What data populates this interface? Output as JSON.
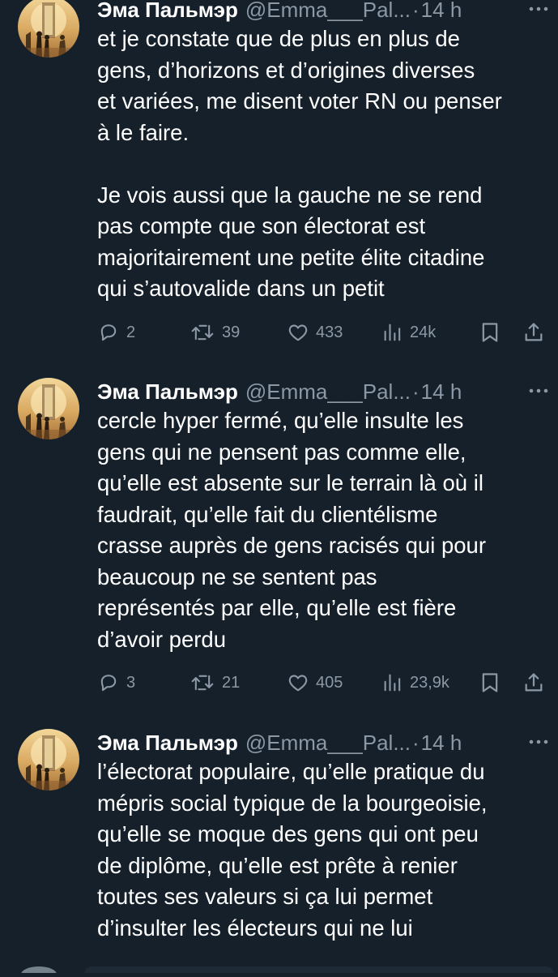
{
  "tweets": [
    {
      "name": "Эма Пальмэр",
      "handle": "@Emma___Pal...",
      "dot": "·",
      "time": "14 h",
      "text": "et je constate que de plus en plus de\ngens, d’horizons et d’origines diverses\net variées, me disent voter RN ou penser\nà le faire.\n\nJe vois aussi que la gauche ne se rend\npas compte que son électorat est\nmajoritairement une petite élite citadine\nqui s’autovalide dans un petit",
      "replies": "2",
      "retweets": "39",
      "likes": "433",
      "views": "24k"
    },
    {
      "name": "Эма Пальмэр",
      "handle": "@Emma___Pal...",
      "dot": "·",
      "time": "14 h",
      "text": "cercle hyper fermé, qu’elle insulte les\ngens qui ne pensent pas comme elle,\nqu’elle est absente sur le terrain là où il\nfaudrait, qu’elle fait du clientélisme\ncrasse auprès de gens racisés qui pour\nbeaucoup ne se sentent pas\nreprésentés par elle, qu’elle est fière\nd’avoir perdu",
      "replies": "3",
      "retweets": "21",
      "likes": "405",
      "views": "23,9k"
    },
    {
      "name": "Эма Пальмэр",
      "handle": "@Emma___Pal...",
      "dot": "·",
      "time": "14 h",
      "text": "l’électorat populaire, qu’elle pratique du\nmépris social typique de la bourgeoisie,\nqu’elle se moque des gens qui ont peu\nde diplôme, qu’elle est prête à renier\ntoutes ses valeurs si ça lui permet\nd’insulter les électeurs qui ne lui"
    }
  ],
  "icons": {
    "reply": "reply-icon",
    "retweet": "retweet-icon",
    "like": "heart-icon",
    "views": "views-icon",
    "bookmark": "bookmark-icon",
    "share": "share-icon",
    "more": "more-icon"
  },
  "colors": {
    "background": "#15202b",
    "text": "#ffffff",
    "secondary": "#8b98a5"
  }
}
